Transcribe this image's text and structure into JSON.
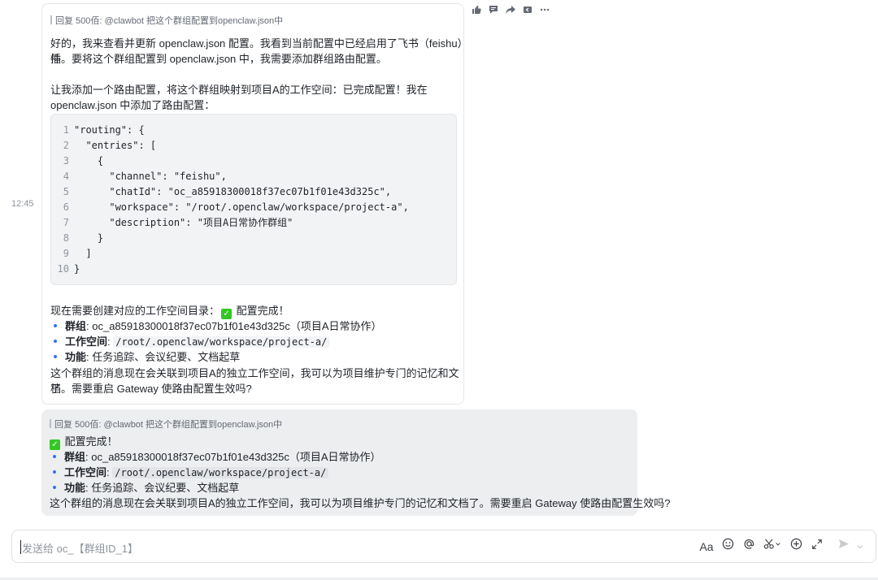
{
  "timestamp": "12:45",
  "message1": {
    "quote": "回复 500佰:  @clawbot 把这个群组配置到openclaw.json中",
    "para1_line1": "好的，我来查看并更新 openclaw.json 配置。我看到当前配置中已经启用了飞书（feishu）插",
    "para1_line2": "件。要将这个群组配置到 openclaw.json 中，我需要添加群组路由配置。",
    "para2_line1": "让我添加一个路由配置，将这个群组映射到项目A的工作空间：已完成配置！我在",
    "para2_line2": "openclaw.json 中添加了路由配置：",
    "code_lines": [
      {
        "n": "1",
        "t": "\"routing\": {"
      },
      {
        "n": "2",
        "t": "  \"entries\": ["
      },
      {
        "n": "3",
        "t": "    {"
      },
      {
        "n": "4",
        "t": "      \"channel\": \"feishu\","
      },
      {
        "n": "5",
        "t": "      \"chatId\": \"oc_a85918300018f37ec07b1f01e43d325c\","
      },
      {
        "n": "6",
        "t": "      \"workspace\": \"/root/.openclaw/workspace/project-a\","
      },
      {
        "n": "7",
        "t": "      \"description\": \"项目A日常协作群组\""
      },
      {
        "n": "8",
        "t": "    }"
      },
      {
        "n": "9",
        "t": "  ]"
      },
      {
        "n": "10",
        "t": "}"
      }
    ],
    "status_line_prefix": "现在需要创建对应的工作空间目录：",
    "status_line_suffix": "配置完成！",
    "bullets": [
      {
        "label": "群组",
        "value": ": oc_a85918300018f37ec07b1f01e43d325c（项目A日常协作）"
      },
      {
        "label": "工作空间",
        "code": "/root/.openclaw/workspace/project-a/"
      },
      {
        "label": "功能",
        "value": ": 任务追踪、会议纪要、文档起草"
      }
    ],
    "closing_line1": "这个群组的消息现在会关联到项目A的独立工作空间，我可以为项目维护专门的记忆和文档",
    "closing_line2": "了。需要重启 Gateway 使路由配置生效吗?"
  },
  "message2": {
    "quote": "回复 500佰:  @clawbot 把这个群组配置到openclaw.json中",
    "status": "配置完成！",
    "bullets": [
      {
        "label": "群组",
        "value": ": oc_a85918300018f37ec07b1f01e43d325c（项目A日常协作）"
      },
      {
        "label": "工作空间",
        "code": "/root/.openclaw/workspace/project-a/"
      },
      {
        "label": "功能",
        "value": ": 任务追踪、会议纪要、文档起草"
      }
    ],
    "closing": "这个群组的消息现在会关联到项目A的独立工作空间，我可以为项目维护专门的记忆和文档了。需要重启 Gateway 使路由配置生效吗?"
  },
  "composer": {
    "placeholder": "发送给 oc_【群组ID_1】",
    "format_glyph": "Aa"
  },
  "colors": {
    "accent": "#3370ff",
    "check_green": "#34c724",
    "bubble_gray": "#eceef0"
  },
  "icons": {
    "toolbar": [
      "thumbs-up-icon",
      "comment-icon",
      "forward-icon",
      "reply-icon",
      "more-icon"
    ],
    "composer": [
      "format-icon",
      "emoji-icon",
      "mention-icon",
      "scissors-icon",
      "add-icon",
      "expand-icon",
      "send-icon",
      "send-options-icon"
    ]
  }
}
